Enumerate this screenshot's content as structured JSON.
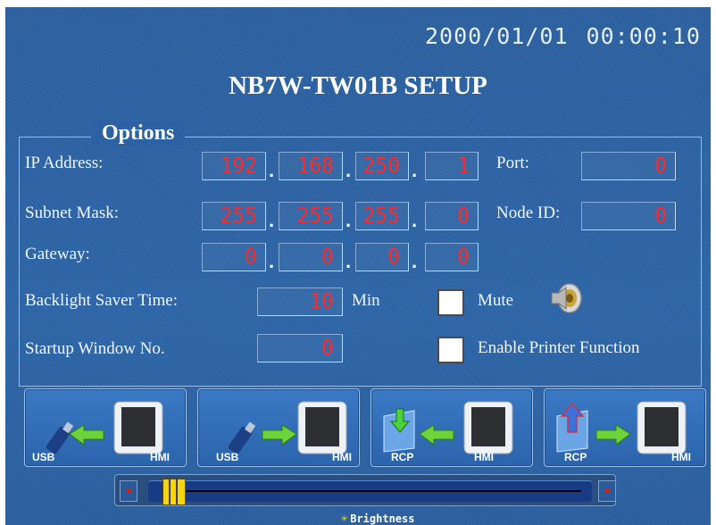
{
  "header": {
    "date": "2000/01/01",
    "time": "00:00:10",
    "title": "NB7W-TW01B SETUP"
  },
  "options": {
    "legend": "Options",
    "ip_address": {
      "label": "IP Address:",
      "octets": [
        "192",
        "168",
        "250",
        "1"
      ]
    },
    "subnet_mask": {
      "label": "Subnet Mask:",
      "octets": [
        "255",
        "255",
        "255",
        "0"
      ]
    },
    "gateway": {
      "label": "Gateway:",
      "octets": [
        "0",
        "0",
        "0",
        "0"
      ]
    },
    "port": {
      "label": "Port:",
      "value": "0"
    },
    "node_id": {
      "label": "Node ID:",
      "value": "0"
    },
    "backlight_saver": {
      "label": "Backlight Saver Time:",
      "value": "10",
      "unit": "Min"
    },
    "startup_window": {
      "label": "Startup Window No.",
      "value": "0"
    },
    "mute": {
      "label": "Mute",
      "checked": false
    },
    "printer": {
      "label": "Enable Printer Function",
      "checked": false
    },
    "separator": "."
  },
  "transfer_buttons": [
    {
      "source": "USB",
      "target": "HMI",
      "direction": "to-source"
    },
    {
      "source": "USB",
      "target": "HMI",
      "direction": "to-target"
    },
    {
      "source": "RCP",
      "target": "HMI",
      "direction": "to-source"
    },
    {
      "source": "RCP",
      "target": "HMI",
      "direction": "to-target"
    }
  ],
  "brightness": {
    "label": "Brightness",
    "decrease": "-",
    "increase": "+",
    "level": 0.03
  },
  "colors": {
    "background": "#2c64a6",
    "field_text": "#ff2a2a",
    "slider_thumb": "#f5d60a"
  },
  "icons": [
    "usb-drive-icon",
    "hmi-monitor-icon",
    "rcp-download-icon",
    "rcp-upload-icon",
    "arrow-icon",
    "speaker-icon",
    "sun-icon"
  ]
}
